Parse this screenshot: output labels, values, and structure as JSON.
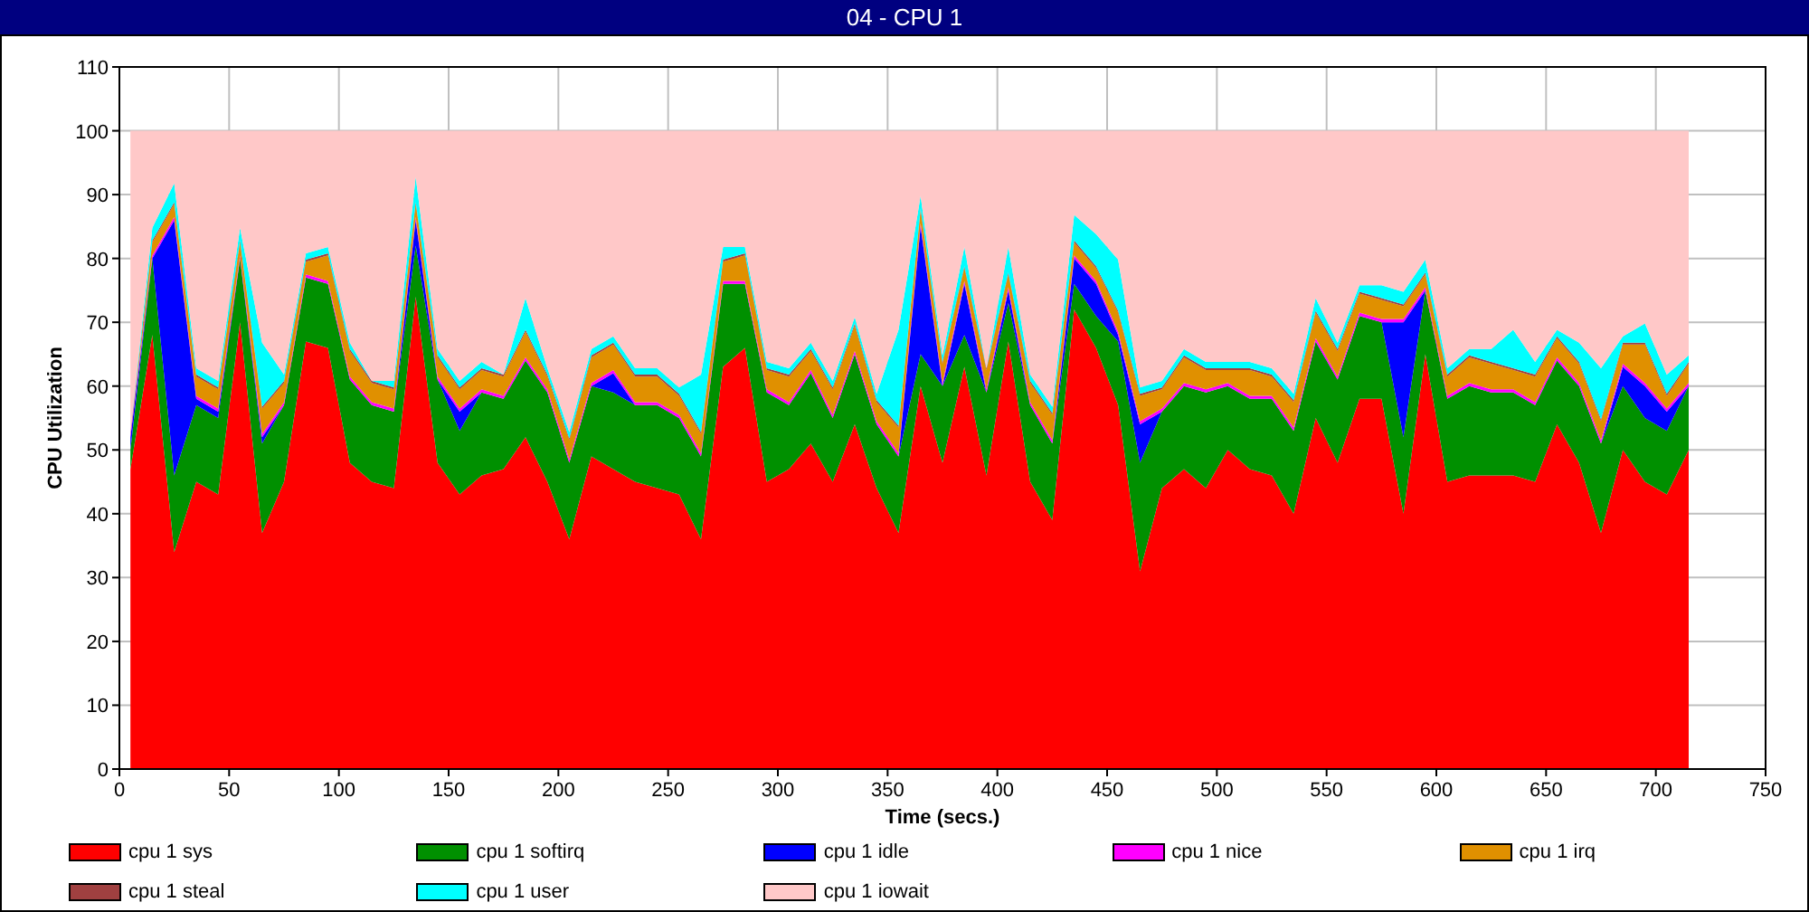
{
  "window": {
    "title": "04 - CPU 1"
  },
  "chart_data": {
    "type": "area",
    "stacked": true,
    "grid": true,
    "legend": true,
    "xlabel": "Time (secs.)",
    "ylabel": "CPU Utilization",
    "xlim": [
      0,
      750
    ],
    "ylim": [
      0,
      110
    ],
    "xticks": [
      0,
      50,
      100,
      150,
      200,
      250,
      300,
      350,
      400,
      450,
      500,
      550,
      600,
      650,
      700,
      750
    ],
    "yticks": [
      0,
      10,
      20,
      30,
      40,
      50,
      60,
      70,
      80,
      90,
      100,
      110
    ],
    "x": [
      5,
      15,
      25,
      35,
      45,
      55,
      65,
      75,
      85,
      95,
      105,
      115,
      125,
      135,
      145,
      155,
      165,
      175,
      185,
      195,
      205,
      215,
      225,
      235,
      245,
      255,
      265,
      275,
      285,
      295,
      305,
      315,
      325,
      335,
      345,
      355,
      365,
      375,
      385,
      395,
      405,
      415,
      425,
      435,
      445,
      455,
      465,
      475,
      485,
      495,
      505,
      515,
      525,
      535,
      545,
      555,
      565,
      575,
      585,
      595,
      605,
      615,
      625,
      635,
      645,
      655,
      665,
      675,
      685,
      695,
      705,
      715
    ],
    "series": [
      {
        "name": "cpu 1 sys",
        "color": "#ff0000",
        "values": [
          47,
          68,
          34,
          45,
          43,
          70,
          37,
          45,
          67,
          66,
          48,
          45,
          44,
          74,
          48,
          43,
          46,
          47,
          52,
          45,
          36,
          49,
          47,
          45,
          44,
          43,
          36,
          63,
          66,
          45,
          47,
          51,
          45,
          54,
          44,
          37,
          60,
          48,
          63,
          46,
          67,
          45,
          39,
          72,
          66,
          57,
          31,
          44,
          47,
          44,
          50,
          47,
          46,
          40,
          55,
          48,
          58,
          58,
          40,
          65,
          45,
          46,
          46,
          46,
          45,
          54,
          48,
          37,
          50,
          45,
          43,
          50
        ]
      },
      {
        "name": "cpu 1 softirq",
        "color": "#009000",
        "values": [
          3,
          12,
          12,
          12,
          12,
          10,
          14,
          12,
          10,
          10,
          13,
          12,
          12,
          8,
          13,
          10,
          13,
          11,
          12,
          14,
          12,
          11,
          12,
          12,
          13,
          12,
          13,
          13,
          10,
          14,
          10,
          11,
          10,
          11,
          10,
          12,
          5,
          12,
          5,
          13,
          6,
          12,
          12,
          4,
          5,
          10,
          17,
          12,
          13,
          15,
          10,
          11,
          12,
          13,
          12,
          13,
          13,
          12,
          12,
          10,
          13,
          14,
          13,
          13,
          12,
          10,
          12,
          14,
          10,
          10,
          10,
          10
        ]
      },
      {
        "name": "cpu 1 idle",
        "color": "#0000ff",
        "values": [
          2,
          0,
          40,
          1,
          1,
          0,
          1,
          0,
          0,
          0,
          0,
          0,
          0,
          4,
          0,
          3,
          0,
          0,
          0,
          0,
          0,
          0,
          3,
          0,
          0,
          0,
          0,
          0,
          0,
          0,
          0,
          0,
          0,
          0,
          0,
          0,
          20,
          0,
          8,
          0,
          2,
          0,
          0,
          4,
          5,
          1,
          6,
          0,
          0,
          0,
          0,
          0,
          0,
          0,
          0,
          0,
          0,
          0,
          18,
          0,
          0,
          0,
          0,
          0,
          0,
          0,
          0,
          0,
          3,
          5,
          3,
          0
        ]
      },
      {
        "name": "cpu 1 nice",
        "color": "#ff00ff",
        "values": [
          0.5,
          0.5,
          0.5,
          0.5,
          0.5,
          0.5,
          0.5,
          0.5,
          0.5,
          0.5,
          0.5,
          0.5,
          0.5,
          0.5,
          0.5,
          0.5,
          0.5,
          0.5,
          0.5,
          0.5,
          0.5,
          0.5,
          0.5,
          0.5,
          0.5,
          0.5,
          0.5,
          0.5,
          0.5,
          0.5,
          0.5,
          0.5,
          0.5,
          0.5,
          0.5,
          0.5,
          0.5,
          0.5,
          0.5,
          0.5,
          0.5,
          0.5,
          0.5,
          0.5,
          0.5,
          0.5,
          0.5,
          0.5,
          0.5,
          0.5,
          0.5,
          0.5,
          0.5,
          0.5,
          0.5,
          0.5,
          0.5,
          0.5,
          0.5,
          0.5,
          0.5,
          0.5,
          0.5,
          0.5,
          0.5,
          0.5,
          0.5,
          0.5,
          0.5,
          0.5,
          0.5,
          0.5
        ]
      },
      {
        "name": "cpu 1 irq",
        "color": "#e09000",
        "values": [
          0,
          2,
          2,
          3,
          3,
          2,
          4,
          3,
          2,
          4,
          4,
          3,
          3,
          2,
          3,
          3,
          3,
          3,
          4,
          2,
          3,
          4,
          4,
          4,
          4,
          3,
          3,
          3,
          4,
          3,
          4,
          3,
          4,
          4,
          3,
          4,
          2,
          3,
          2,
          3,
          2,
          3,
          4,
          2,
          2,
          3,
          4,
          3,
          4,
          3,
          2,
          4,
          3,
          4,
          4,
          4,
          3,
          3,
          2,
          2,
          3,
          4,
          4,
          3,
          4,
          3,
          3,
          3,
          3,
          6,
          2,
          3
        ]
      },
      {
        "name": "cpu 1 steal",
        "color": "#a04040",
        "values": [
          0.3,
          0.3,
          0.3,
          0.3,
          0.3,
          0.3,
          0.3,
          0.3,
          0.3,
          0.3,
          0.3,
          0.3,
          0.3,
          0.3,
          0.3,
          0.3,
          0.3,
          0.3,
          0.3,
          0.3,
          0.3,
          0.3,
          0.3,
          0.3,
          0.3,
          0.3,
          0.3,
          0.3,
          0.3,
          0.3,
          0.3,
          0.3,
          0.3,
          0.3,
          0.3,
          0.3,
          0.3,
          0.3,
          0.3,
          0.3,
          0.3,
          0.3,
          0.3,
          0.3,
          0.3,
          0.3,
          0.3,
          0.3,
          0.3,
          0.3,
          0.3,
          0.3,
          0.3,
          0.3,
          0.3,
          0.3,
          0.3,
          0.3,
          0.3,
          0.3,
          0.3,
          0.3,
          0.3,
          0.3,
          0.3,
          0.3,
          0.3,
          0.3,
          0.3,
          0.3,
          0.3,
          0.3
        ]
      },
      {
        "name": "cpu 1 user",
        "color": "#00ffff",
        "values": [
          0,
          2,
          3,
          1,
          1,
          2,
          10,
          1,
          1,
          1,
          1,
          0,
          1,
          4,
          1,
          1,
          1,
          0,
          5,
          1,
          1,
          1,
          1,
          1,
          1,
          1,
          9,
          2,
          1,
          1,
          1,
          1,
          1,
          1,
          1,
          15,
          2,
          1,
          3,
          0,
          4,
          1,
          1,
          4,
          5,
          8,
          1,
          1,
          1,
          1,
          1,
          1,
          1,
          1,
          2,
          1,
          1,
          2,
          2,
          2,
          1,
          1,
          2,
          6,
          2,
          1,
          3,
          8,
          1,
          3,
          3,
          1
        ]
      },
      {
        "name": "cpu 1 iowait",
        "color": "#ffc8c8",
        "values": [
          47.2,
          15.2,
          8.2,
          37.2,
          39.2,
          15.2,
          33.2,
          38.2,
          19.2,
          18.2,
          33.2,
          39.2,
          39.2,
          7.2,
          34.2,
          39.2,
          36.2,
          38.2,
          26.2,
          37.2,
          47.2,
          34.2,
          32.2,
          37.2,
          37.2,
          40.2,
          38.2,
          18.2,
          18.2,
          36.2,
          37.2,
          33.2,
          39.2,
          29.2,
          41.2,
          31.2,
          10.2,
          35.2,
          18.2,
          37.2,
          18.2,
          38.2,
          43.2,
          13.2,
          16.2,
          20.2,
          40.2,
          39.2,
          34.2,
          36.2,
          36.2,
          36.2,
          37.2,
          41.2,
          26.2,
          33.2,
          24.2,
          24.2,
          25.2,
          20.2,
          37.2,
          34.2,
          34.2,
          31.2,
          36.2,
          31.2,
          33.2,
          37.2,
          32.2,
          30.2,
          38.2,
          35.2
        ]
      }
    ]
  }
}
